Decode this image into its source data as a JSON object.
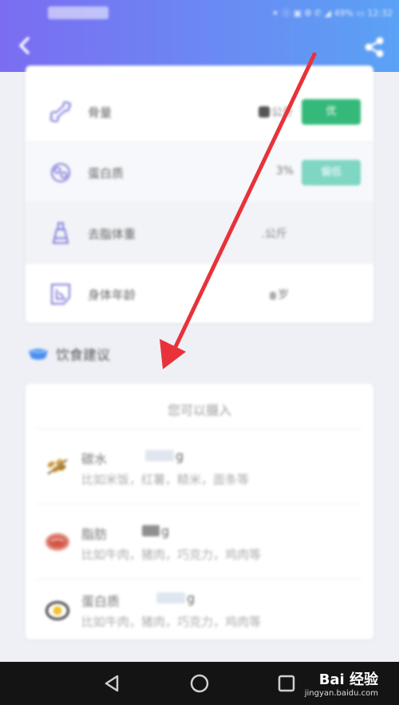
{
  "status_bar": {
    "left_small": "",
    "right_text": "✶ ⓥ ▣ ⦾ ✆ ◢ 49% ▭ 12:32"
  },
  "header": {
    "back_icon": "chevron-left-icon",
    "share_icon": "share-icon"
  },
  "metrics": [
    {
      "icon": "bone-icon",
      "label": "骨量",
      "value": "公斤",
      "badge": "优",
      "badge_color": "#35b97a"
    },
    {
      "icon": "protein-icon",
      "label": "蛋白质",
      "value": "3%",
      "badge": "偏低",
      "badge_color": "#7fd6c3"
    },
    {
      "icon": "flask-icon",
      "label": "去脂体重",
      "value": ".公斤",
      "badge": ""
    },
    {
      "icon": "body-age-icon",
      "label": "身体年龄",
      "value": "岁",
      "badge": ""
    }
  ],
  "diet": {
    "title": "饮食建议",
    "icon": "bowl-icon",
    "intake_heading": "您可以摄入",
    "foods": [
      {
        "icon": "grain-icon",
        "name": "碳水",
        "amount": "g",
        "hint": "比如米饭，红薯，糙米，面条等"
      },
      {
        "icon": "meat-icon",
        "name": "脂肪",
        "amount": "g",
        "hint": "比如牛肉，猪肉，巧克力，鸡肉等"
      },
      {
        "icon": "egg-icon",
        "name": "蛋白质",
        "amount": "g",
        "hint": "比如牛肉，猪肉，巧克力，鸡肉等"
      }
    ]
  },
  "nav": {
    "back": "triangle-back-icon",
    "home": "circle-home-icon",
    "recent": "square-recent-icon"
  },
  "watermark": {
    "brand": "Bai 经验",
    "url": "jingyan.baidu.com"
  },
  "colors": {
    "gradient_start": "#7b6cf1",
    "gradient_end": "#5aa2f5",
    "arrow": "#e8323a"
  }
}
